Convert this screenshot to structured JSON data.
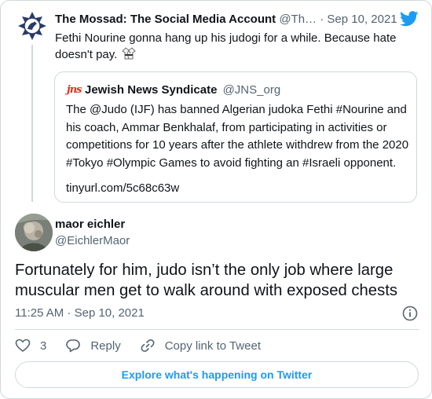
{
  "parent_tweet": {
    "author_name": "The Mossad: The Social Media Account",
    "author_handle": "@Th…",
    "separator": " · ",
    "date": "Sep 10, 2021",
    "text": "Fethi Nourine gonna hang up his judogi for a while. Because hate doesn't pay.",
    "avatar_icon": "mossad-emblem-icon",
    "emoji_icon": "martial-arts-uniform-icon"
  },
  "quoted_tweet": {
    "logo_text": "jns",
    "author_name": "Jewish News Syndicate",
    "author_handle": "@JNS_org",
    "text": "The @Judo (IJF) has banned Algerian judoka Fethi #Nourine and his coach, Ammar Benkhalaf, from participating in activities or competitions for 10 years after the athlete withdrew from the 2020 #Tokyo #Olympic Games to avoid fighting an #Israeli opponent.",
    "link": "tinyurl.com/5c68c63w"
  },
  "reply_tweet": {
    "author_name": "maor eichler",
    "author_handle": "@EichlerMaor",
    "text": "Fortunately for him, judo isn’t the only job where large muscular men get to walk around with exposed chests",
    "timestamp": "11:25 AM · Sep 10, 2021"
  },
  "actions": {
    "like_count": "3",
    "reply_label": "Reply",
    "copy_link_label": "Copy link to Tweet"
  },
  "explore_label": "Explore what's happening on Twitter",
  "colors": {
    "accent": "#1d9bf0",
    "text": "#0f1419",
    "secondary_text": "#536471",
    "border": "#cfd9de",
    "jns_red": "#e0321c"
  }
}
